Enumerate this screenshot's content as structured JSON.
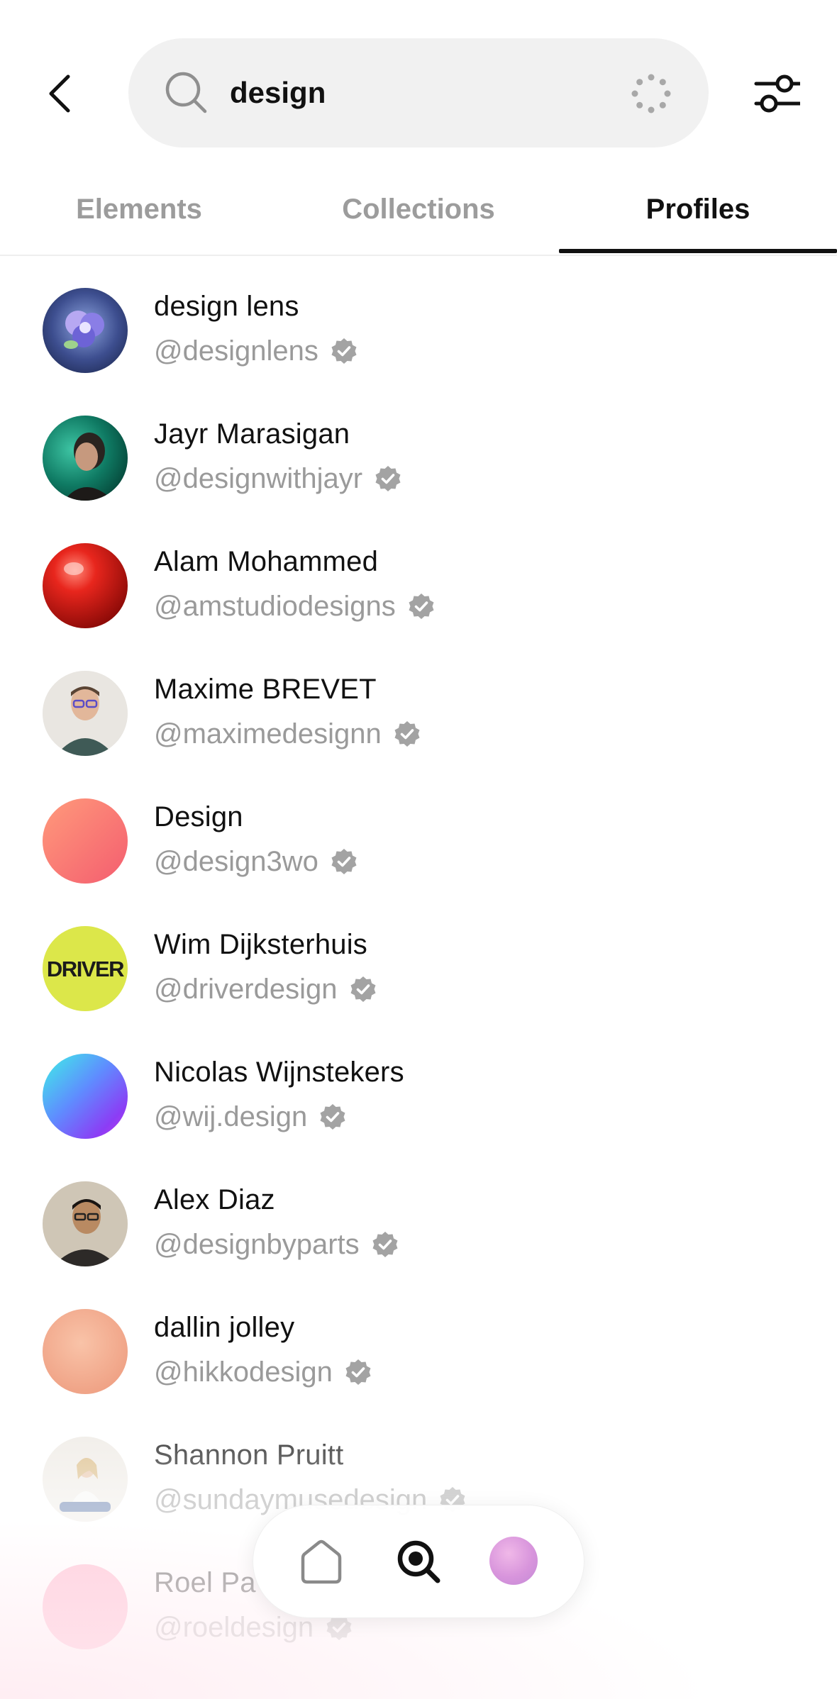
{
  "search": {
    "value": "design",
    "icons": {
      "search": "search-icon",
      "loading": "spinner-icon",
      "back": "chevron-left-icon",
      "filter": "sliders-icon"
    }
  },
  "tabs": [
    {
      "label": "Elements",
      "active": false
    },
    {
      "label": "Collections",
      "active": false
    },
    {
      "label": "Profiles",
      "active": true
    }
  ],
  "profiles": [
    {
      "name": "design lens",
      "handle": "@designlens",
      "verified": true
    },
    {
      "name": "Jayr Marasigan",
      "handle": "@designwithjayr",
      "verified": true
    },
    {
      "name": "Alam Mohammed",
      "handle": "@amstudiodesigns",
      "verified": true
    },
    {
      "name": "Maxime BREVET",
      "handle": "@maximedesignn",
      "verified": true
    },
    {
      "name": "Design",
      "handle": "@design3wo",
      "verified": true
    },
    {
      "name": "Wim Dijksterhuis",
      "handle": "@driverdesign",
      "verified": true,
      "avatar_text": "DRIVER"
    },
    {
      "name": "Nicolas Wijnstekers",
      "handle": "@wij.design",
      "verified": true
    },
    {
      "name": "Alex Diaz",
      "handle": "@designbyparts",
      "verified": true
    },
    {
      "name": "dallin jolley",
      "handle": "@hikkodesign",
      "verified": true
    },
    {
      "name": "Shannon Pruitt",
      "handle": "@sundaymusedesign",
      "verified": true
    },
    {
      "name": "Roel Pa",
      "handle": "@roeldesign",
      "verified": true
    }
  ],
  "bottom_nav": {
    "items": [
      "home-icon",
      "search-icon",
      "profile-avatar"
    ],
    "active": "search-icon"
  },
  "colors": {
    "text_primary": "#111111",
    "text_secondary": "#9a9a9a",
    "search_bg": "#f1f1f1",
    "verified_badge": "#a3a3a3"
  }
}
